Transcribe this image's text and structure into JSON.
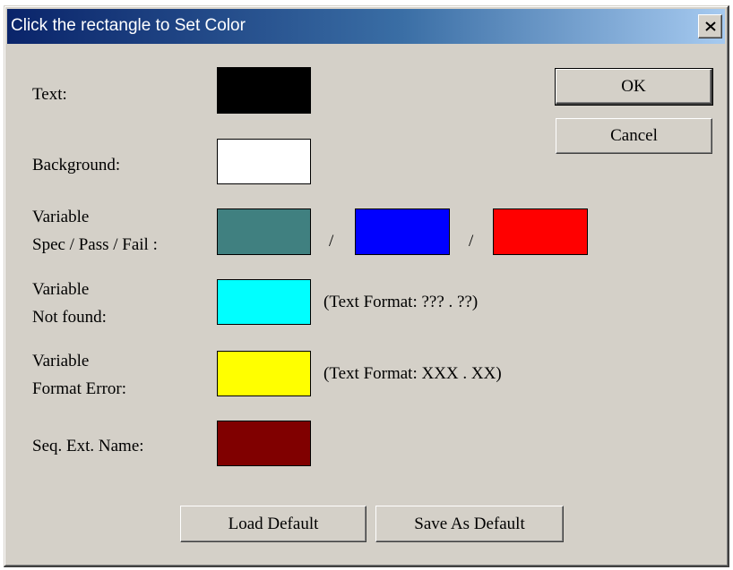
{
  "window": {
    "title": "Click the rectangle to Set Color"
  },
  "titlebar": {
    "close_icon": "close-icon",
    "gradient_start": "#0a246a",
    "gradient_end": "#a6caf0"
  },
  "rows": {
    "text": {
      "label": "Text:",
      "color": "#000000"
    },
    "background": {
      "label": "Background:",
      "color": "#ffffff"
    },
    "variable_spec": {
      "label_line1": "Variable",
      "label_line2": "Spec / Pass / Fail :",
      "spec_color": "#408080",
      "pass_color": "#0000ff",
      "fail_color": "#ff0000",
      "separator": "/"
    },
    "variable_not_found": {
      "label_line1": "Variable",
      "label_line2": "Not found:",
      "color": "#00ffff",
      "note": "(Text Format: ??? . ??)"
    },
    "variable_format_error": {
      "label_line1": "Variable",
      "label_line2": "Format Error:",
      "color": "#ffff00",
      "note": "(Text Format: XXX . XX)"
    },
    "seq_ext_name": {
      "label": "Seq. Ext. Name:",
      "color": "#800000"
    }
  },
  "buttons": {
    "ok": "OK",
    "cancel": "Cancel",
    "load_default": "Load Default",
    "save_as_default": "Save As Default"
  }
}
